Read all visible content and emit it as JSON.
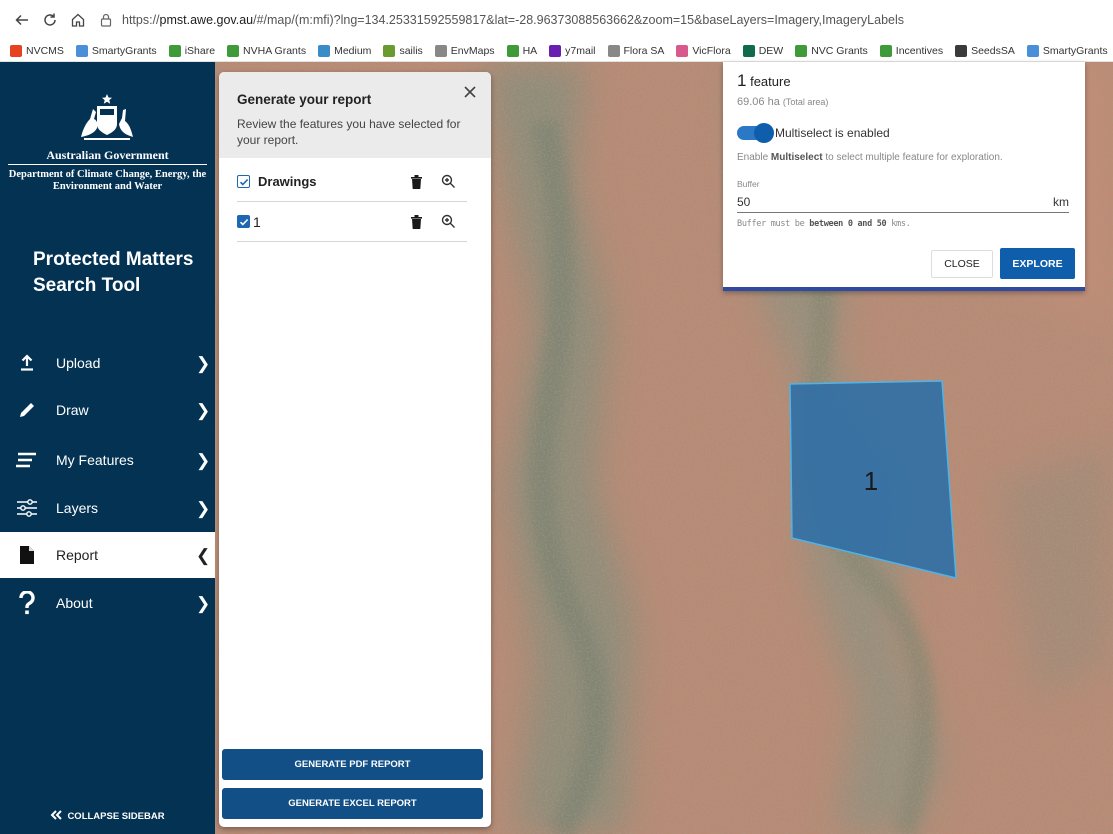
{
  "browser": {
    "url_prefix": "https://",
    "url_domain": "pmst.awe.gov.au",
    "url_rest": "/#/map/(m:mfi)?lng=134.25331592559817&lat=-28.96373088563662&zoom=15&baseLayers=Imagery,ImageryLabels",
    "bookmarks": [
      {
        "label": "NVCMS",
        "color": "#e7421f"
      },
      {
        "label": "SmartyGrants",
        "color": "#4a8fd8"
      },
      {
        "label": "iShare",
        "color": "#3f9b3a"
      },
      {
        "label": "NVHA Grants",
        "color": "#3f9b3a"
      },
      {
        "label": "Medium",
        "color": "#3a8cc9"
      },
      {
        "label": "sailis",
        "color": "#6a9b2f"
      },
      {
        "label": "EnvMaps",
        "color": "#888888"
      },
      {
        "label": "HA",
        "color": "#3f9b3a"
      },
      {
        "label": "y7mail",
        "color": "#6b1fb1"
      },
      {
        "label": "Flora SA",
        "color": "#888888"
      },
      {
        "label": "VicFlora",
        "color": "#d85a8c"
      },
      {
        "label": "DEW",
        "color": "#106b4a"
      },
      {
        "label": "NVC Grants",
        "color": "#3f9b3a"
      },
      {
        "label": "Incentives",
        "color": "#3f9b3a"
      },
      {
        "label": "SeedsSA",
        "color": "#3a3a3a"
      },
      {
        "label": "SmartyGrants",
        "color": "#4a8fd8"
      }
    ]
  },
  "sidebar": {
    "gov_name": "Australian Government",
    "department": "Department of Climate Change, Energy, the Environment and Water",
    "app_title": "Protected Matters Search Tool",
    "nav": [
      {
        "label": "Upload",
        "icon": "upload-icon",
        "chevron": "❯"
      },
      {
        "label": "Draw",
        "icon": "pencil-icon",
        "chevron": "❯"
      },
      {
        "label": "My Features",
        "icon": "list-icon",
        "chevron": "❯"
      },
      {
        "label": "Layers",
        "icon": "sliders-icon",
        "chevron": "❯"
      },
      {
        "label": "Report",
        "icon": "document-icon",
        "chevron": "❮",
        "active": true
      },
      {
        "label": "About",
        "icon": "question-icon",
        "chevron": "❯"
      }
    ],
    "collapse_label": "COLLAPSE SIDEBAR"
  },
  "report": {
    "title": "Generate your report",
    "subtitle": "Review the features you have selected for your report.",
    "group_label": "Drawings",
    "feature_label": "1",
    "pdf_button": "GENERATE PDF REPORT",
    "excel_button": "GENERATE EXCEL REPORT"
  },
  "explore": {
    "feature_count": "1",
    "feature_word": "feature",
    "area_value": "69.06 ha",
    "area_note": "(Total area)",
    "multiselect_label": "Multiselect is enabled",
    "multiselect_enabled": true,
    "hint_prefix": "Enable",
    "hint_bold": "Multiselect",
    "hint_suffix": "to select multiple feature for exploration.",
    "buffer_label": "Buffer",
    "buffer_value": "50",
    "buffer_unit": "km",
    "note_prefix": "Buffer must be",
    "note_bold": "between 0 and 50",
    "note_suffix": "kms.",
    "close_button": "CLOSE",
    "explore_button": "EXPLORE"
  },
  "map": {
    "polygon_label": "1",
    "polygon_color": "#2f6fa6"
  },
  "colors": {
    "sidebar_bg": "#043253",
    "primary": "#124f86",
    "accent": "#0e5eac"
  }
}
